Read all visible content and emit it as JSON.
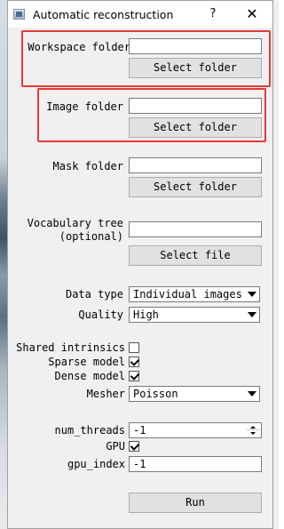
{
  "window": {
    "title": "Automatic reconstruction",
    "help_label": "?",
    "close_label": "✕"
  },
  "workspace": {
    "label": "Workspace folder",
    "value": "",
    "button": "Select folder"
  },
  "image": {
    "label": "Image folder",
    "value": "",
    "button": "Select folder"
  },
  "mask": {
    "label": "Mask folder",
    "value": "",
    "button": "Select folder"
  },
  "vocab": {
    "label": "Vocabulary tree\n(optional)",
    "value": "",
    "button": "Select file"
  },
  "data_type": {
    "label": "Data type",
    "selected": "Individual images"
  },
  "quality": {
    "label": "Quality",
    "selected": "High"
  },
  "shared_intrinsics": {
    "label": "Shared intrinsics",
    "checked": false
  },
  "sparse_model": {
    "label": "Sparse model",
    "checked": true
  },
  "dense_model": {
    "label": "Dense model",
    "checked": true
  },
  "mesher": {
    "label": "Mesher",
    "selected": "Poisson"
  },
  "num_threads": {
    "label": "num_threads",
    "value": "-1"
  },
  "gpu": {
    "label": "GPU",
    "checked": true
  },
  "gpu_index": {
    "label": "gpu_index",
    "value": "-1"
  },
  "run_button": "Run",
  "highlight_color": "#e53939"
}
